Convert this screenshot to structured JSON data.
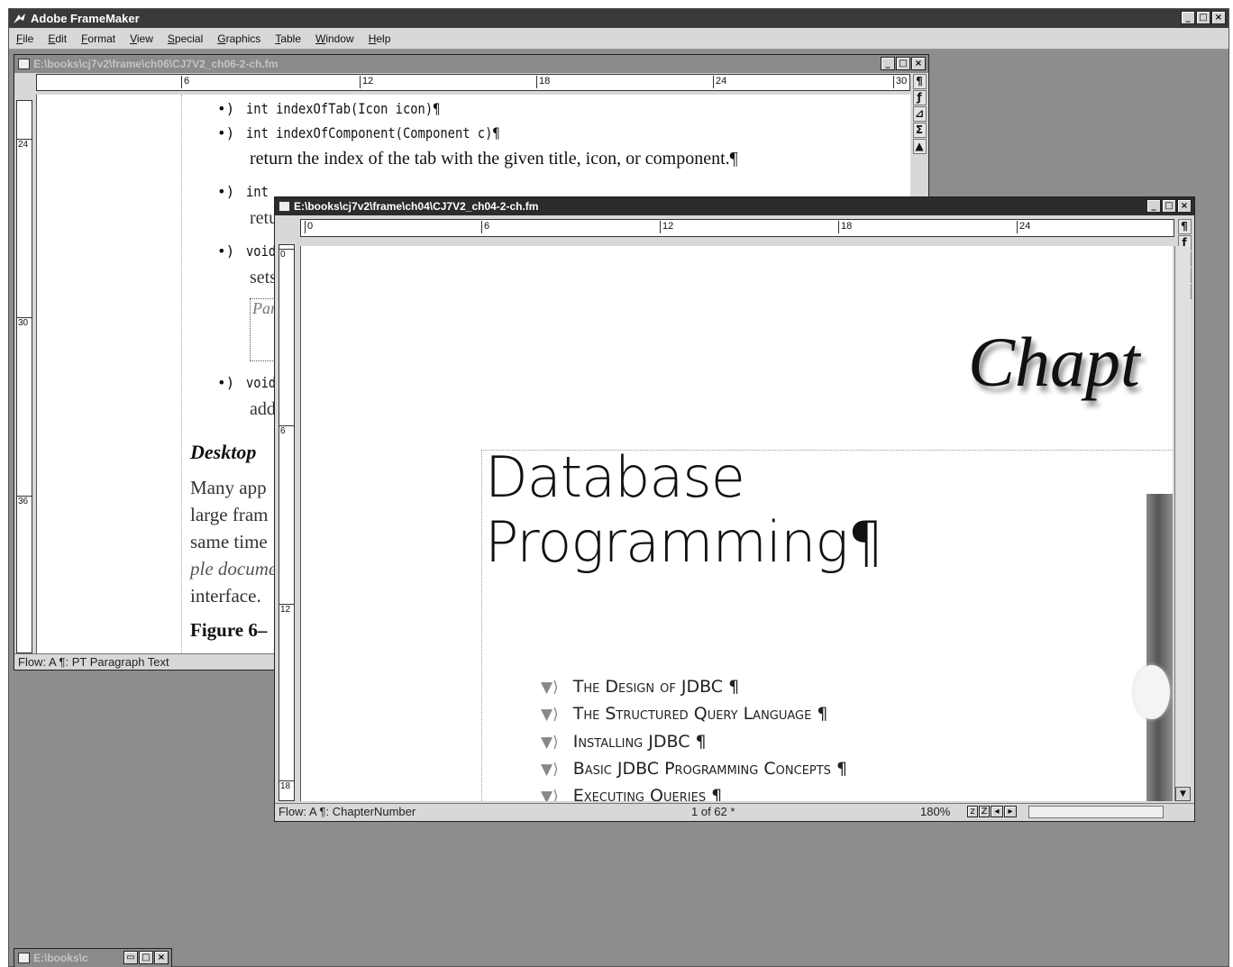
{
  "app": {
    "title": "Adobe FrameMaker",
    "controls": [
      "_",
      "□",
      "×"
    ]
  },
  "menu": [
    "File",
    "Edit",
    "Format",
    "View",
    "Special",
    "Graphics",
    "Table",
    "Window",
    "Help"
  ],
  "back_window": {
    "title": "E:\\books\\cj7v2\\frame\\ch06\\CJ7V2_ch06-2-ch.fm",
    "ruler_labels": [
      "6",
      "12",
      "18",
      "24",
      "30"
    ],
    "vruler_labels": [
      "24",
      "30",
      "36"
    ],
    "lines": [
      {
        "bullet": "•)",
        "code": "int indexOfTab(Icon icon)¶"
      },
      {
        "bullet": "•)",
        "code": "int indexOfComponent(Component c)¶"
      },
      {
        "text": "return the index of the tab with the given title, icon, or component.¶"
      },
      {
        "bullet": "•)",
        "code": "int"
      },
      {
        "text": "retu"
      },
      {
        "bullet": "•)",
        "code": "void"
      },
      {
        "text": "sets"
      },
      {
        "text": "Para"
      },
      {
        "bullet": "•)",
        "code": "void"
      },
      {
        "text": "add"
      }
    ],
    "heading": "Desktop",
    "para_lines": [
      "Many app",
      "large fram",
      "same time",
      "ple docume",
      "interface.",
      "Figure 6–"
    ],
    "status": "Flow: A  ¶: PT Paragraph Text",
    "tools": [
      "¶",
      "ƒ",
      "⊿",
      "Σ",
      "▲"
    ]
  },
  "front_window": {
    "title": "E:\\books\\cj7v2\\frame\\ch04\\CJ7V2_ch04-2-ch.fm",
    "ruler_labels": [
      "0",
      "6",
      "12",
      "18",
      "24"
    ],
    "vruler_labels": [
      "0",
      "6",
      "12",
      "18"
    ],
    "chapter_word": "Chapt",
    "title_line1": "Database",
    "title_line2": "Programming¶",
    "toc": [
      "The Design of JDBC ¶",
      "The Structured Query Language ¶",
      "Installing JDBC ¶",
      "Basic JDBC Programming Concepts ¶",
      "Executing Queries ¶"
    ],
    "status": "Flow: A  ¶: ChapterNumber",
    "page_indicator": "1 of 62 *",
    "zoom": "180%",
    "tools": [
      "¶",
      "ƒ",
      "⊿",
      "Σ",
      "▲"
    ]
  },
  "minimized_window": {
    "title": "E:\\books\\c"
  }
}
